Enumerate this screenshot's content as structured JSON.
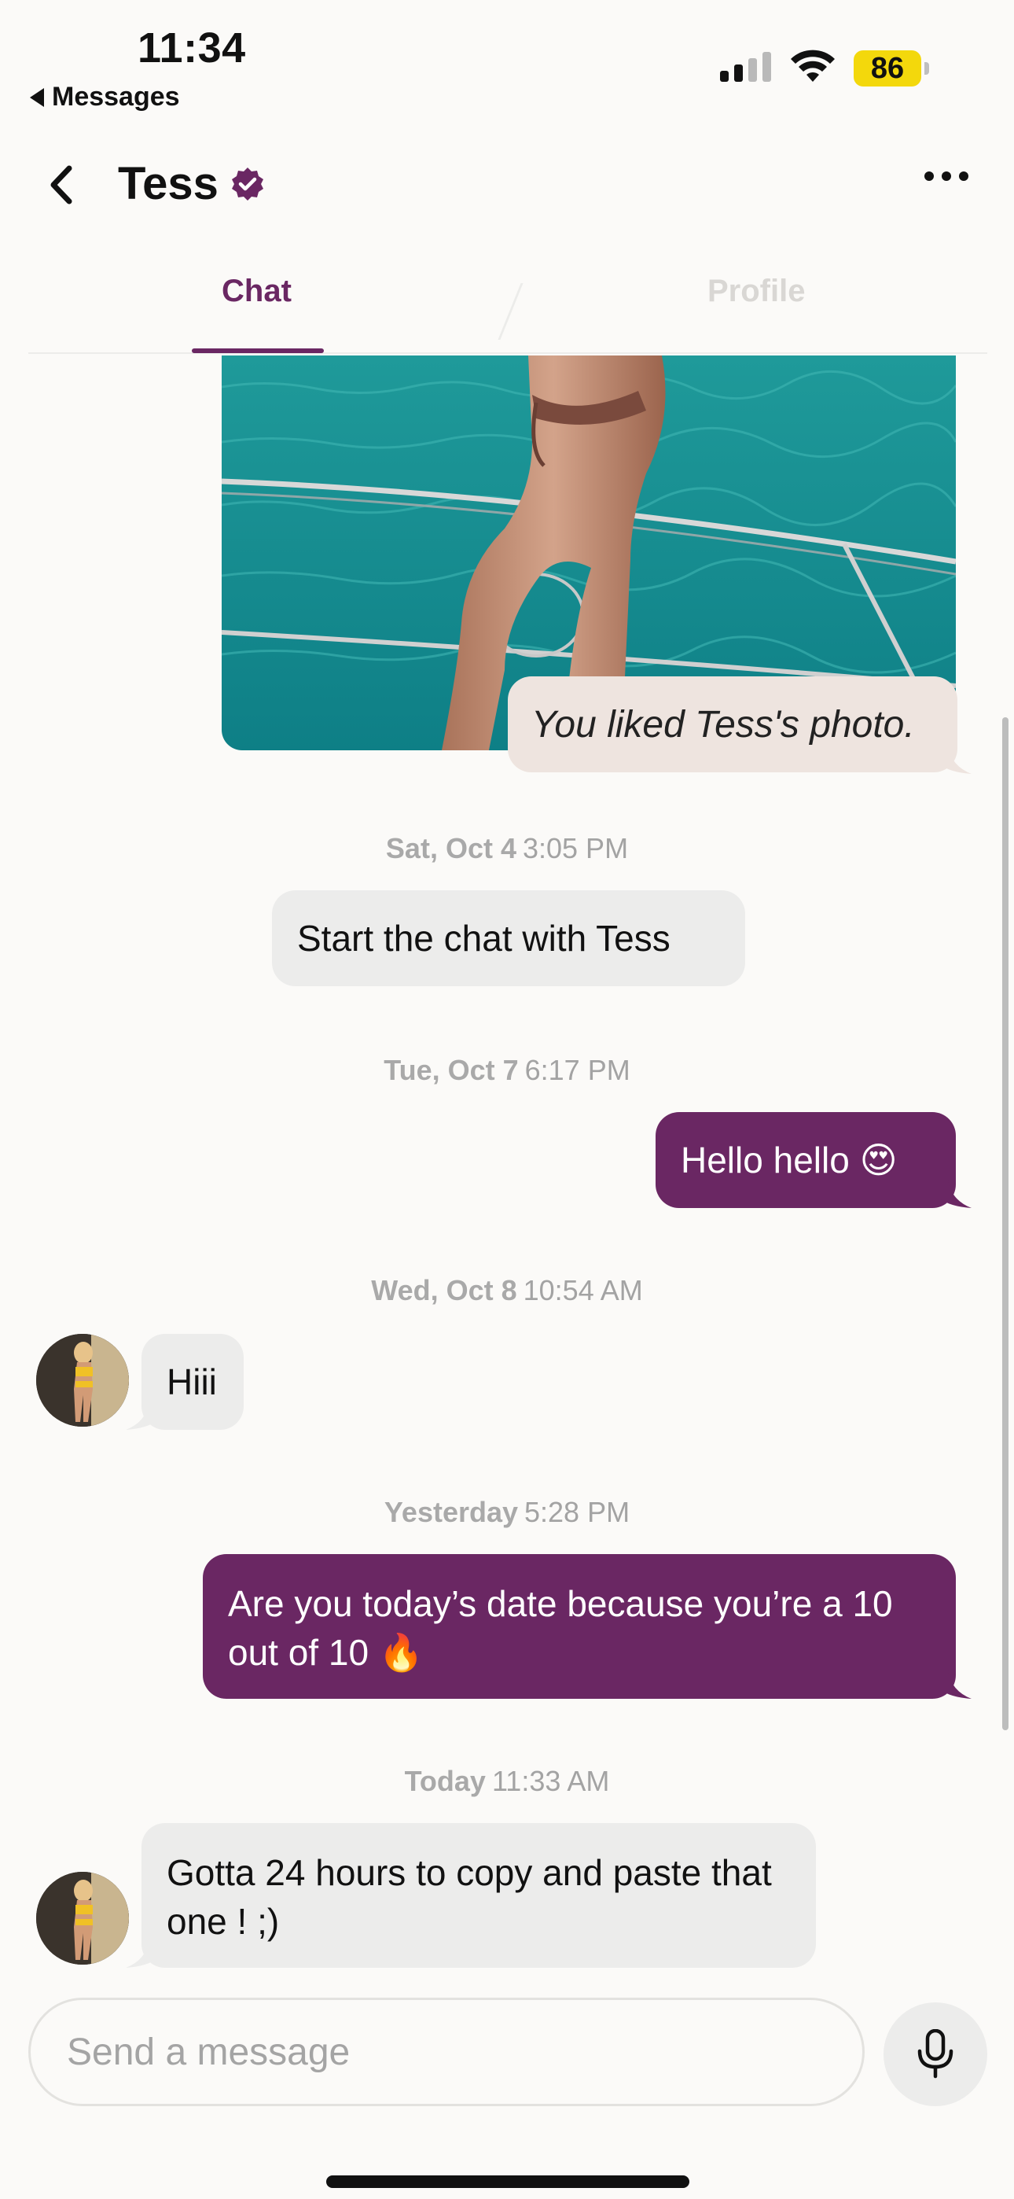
{
  "status_bar": {
    "time": "11:34",
    "back_app": "Messages",
    "battery": "86",
    "icons": [
      "cellular-signal-icon",
      "wifi-icon",
      "battery-icon"
    ]
  },
  "header": {
    "title": "Tess",
    "icons": [
      "chevron-left-icon",
      "verified-badge-icon",
      "more-icon"
    ]
  },
  "tabs": [
    {
      "label": "Chat",
      "active": true
    },
    {
      "label": "Profile",
      "active": false
    }
  ],
  "colors": {
    "accent": "#6a2763",
    "incoming_bubble": "#ececeb",
    "liked_bubble": "#eee4df",
    "background": "#fbfaf8"
  },
  "liked_photo_text": "You liked Tess's photo.",
  "messages": [
    {
      "day": "Sat, Oct 4",
      "time": "3:05 PM",
      "text": "Start the chat with Tess",
      "type": "system"
    },
    {
      "day": "Tue, Oct 7",
      "time": "6:17 PM",
      "text": "Hello hello 😍",
      "type": "outgoing"
    },
    {
      "day": "Wed, Oct 8",
      "time": "10:54 AM",
      "text": "Hiii",
      "type": "incoming"
    },
    {
      "day": "Yesterday",
      "time": "5:28 PM",
      "text": "Are you today’s date because you’re a 10 out of 10 🔥",
      "type": "outgoing"
    },
    {
      "day": "Today",
      "time": "11:33 AM",
      "text": "Gotta 24 hours to copy and paste that one ! ;)",
      "type": "incoming"
    }
  ],
  "composer": {
    "placeholder": "Send a message",
    "icons": [
      "microphone-icon"
    ]
  }
}
